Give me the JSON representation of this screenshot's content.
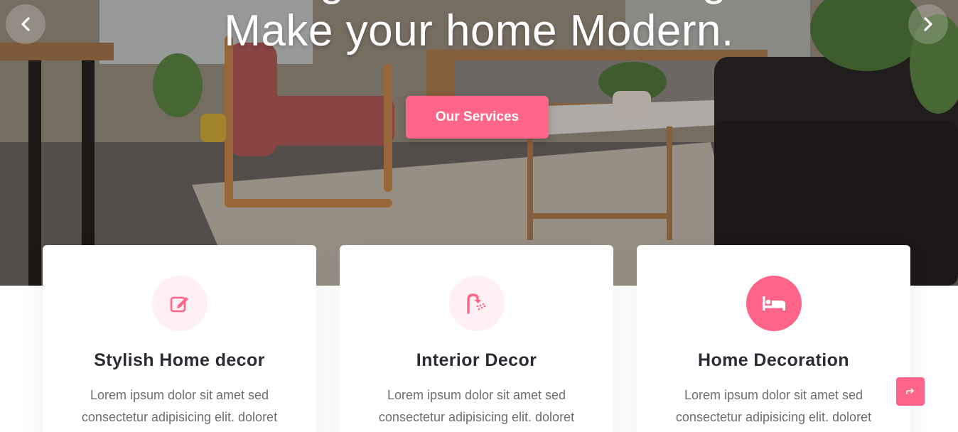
{
  "hero": {
    "title": "Make your home Modern.",
    "title_partial": "Design Your Home Living",
    "cta_label": "Our Services",
    "prev_icon": "chevron-left-icon",
    "next_icon": "chevron-right-icon"
  },
  "services": [
    {
      "icon": "edit-icon",
      "title": "Stylish Home decor",
      "text": "Lorem ipsum dolor sit amet sed consectetur adipisicing elit. doloret"
    },
    {
      "icon": "shower-icon",
      "title": "Interior Decor",
      "text": "Lorem ipsum dolor sit amet sed consectetur adipisicing elit. doloret"
    },
    {
      "icon": "bed-icon",
      "title": "Home Decoration",
      "text": "Lorem ipsum dolor sit amet sed consectetur adipisicing elit. doloret"
    }
  ],
  "scroll_top_icon": "arrow-up-icon",
  "colors": {
    "accent": "#ff6589",
    "accent_light": "#fff0f3",
    "heading": "#2b2b33",
    "body_text": "#6d6d6d"
  }
}
